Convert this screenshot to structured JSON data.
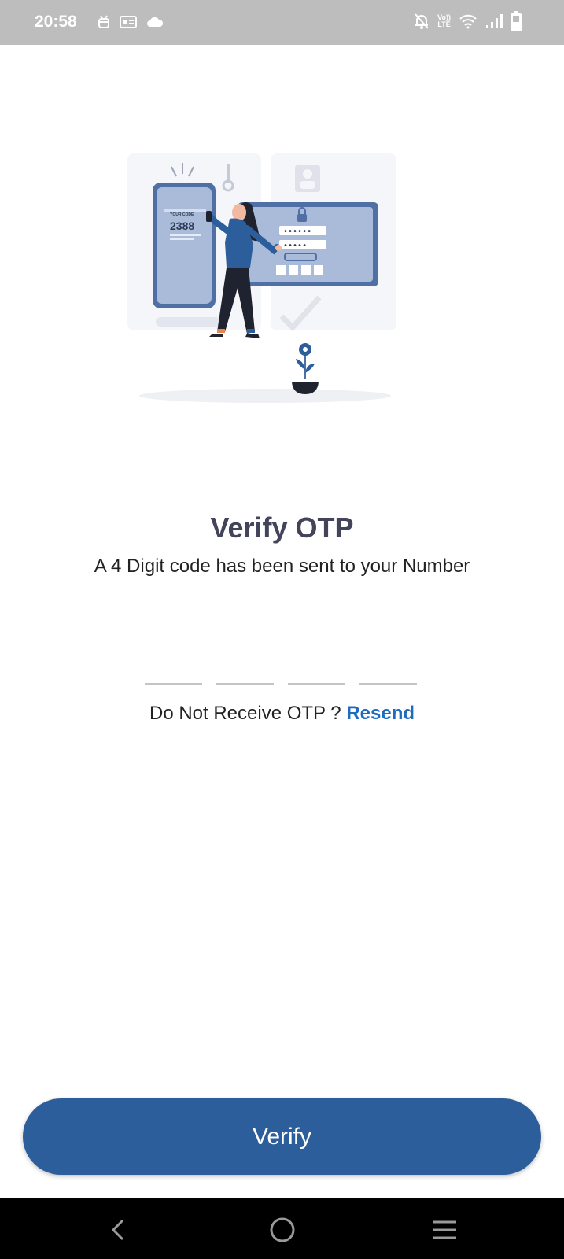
{
  "status_bar": {
    "time": "20:58",
    "left_icons": [
      "android-debug-icon",
      "news-icon",
      "cloud-icon"
    ],
    "right_icons": [
      "mute-bell-icon",
      "volte-icon",
      "wifi-icon",
      "signal-icon",
      "battery-icon"
    ],
    "volte_label_top": "Vo))",
    "volte_label_bottom": "LTE"
  },
  "illustration": {
    "phone_label": "YOUR CODE",
    "phone_code": "2388"
  },
  "main": {
    "title": "Verify OTP",
    "subtitle": "A 4 Digit code has been sent to your Number",
    "otp_fields": [
      "",
      "",
      "",
      ""
    ],
    "resend_prompt": "Do Not Receive OTP ?",
    "resend_link": "Resend"
  },
  "verify_button": {
    "label": "Verify"
  },
  "nav_bar": {
    "buttons": [
      "back-icon",
      "home-icon",
      "menu-icon"
    ]
  },
  "colors": {
    "status_bar_bg": "#bdbdbd",
    "title": "#43435a",
    "accent_link": "#1e6cc0",
    "button_bg": "#2c5e9b",
    "nav_bar_bg": "#000000"
  }
}
